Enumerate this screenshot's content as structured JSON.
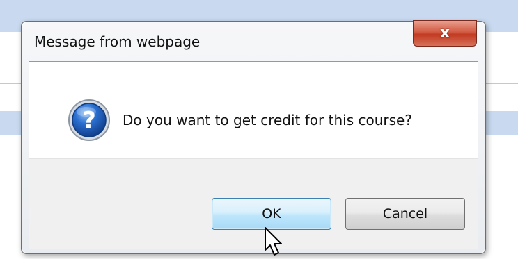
{
  "dialog": {
    "title": "Message from webpage",
    "close_label": "x",
    "message": "Do you want to get credit for this course?",
    "icon": "question-icon",
    "buttons": {
      "ok_label": "OK",
      "cancel_label": "Cancel"
    }
  },
  "colors": {
    "close_button": "#c94a33",
    "ok_button_border": "#3c7fb1",
    "icon_blue": "#1f5fbf"
  }
}
